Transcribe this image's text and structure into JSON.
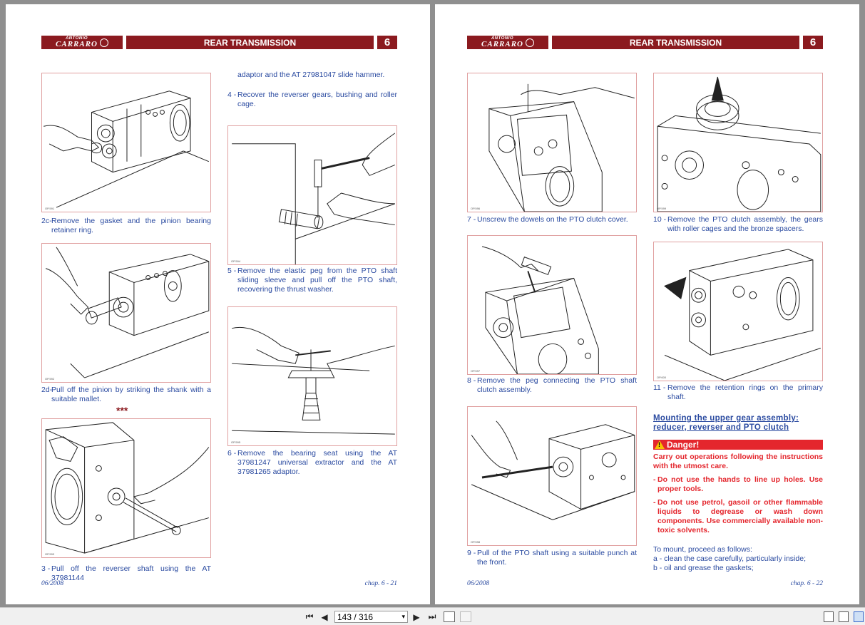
{
  "header": {
    "brand_top": "ANTONIO",
    "brand_bottom": "CARRARO",
    "section_title": "REAR TRANSMISSION",
    "chapter_number": "6"
  },
  "left_page": {
    "fig1_code": "OP.591",
    "fig2_code": "OP.592",
    "fig3_code": "OP.593",
    "fig4_code": "OP.594",
    "fig5_code": "OP.595",
    "step_2c": {
      "num": "2c-",
      "text": "Remove the gasket and the pinion bearing retainer ring."
    },
    "step_2d": {
      "num": "2d-",
      "text": "Pull off the pinion by striking the shank with a suitable mallet."
    },
    "separator": "***",
    "step_3": {
      "num": "3 -",
      "text": "Pull off the reverser shaft using the AT 37981144"
    },
    "cont_text": "adaptor and the AT 27981047 slide hammer.",
    "step_4": {
      "num": "4 -",
      "text": "Recover the reverser gears, bushing and roller cage."
    },
    "step_5": {
      "num": "5 -",
      "text": "Remove the elastic peg from the PTO shaft sliding sleeve and pull off the PTO shaft, recovering the thrust washer."
    },
    "step_6": {
      "num": "6 -",
      "text": "Remove the bearing seat using the AT 37981247 universal extractor and the AT 37981265 adaptor."
    },
    "footer_date": "06/2008",
    "footer_page": "chap. 6 - 21"
  },
  "right_page": {
    "fig1_code": "OP.596",
    "fig2_code": "OP.597",
    "fig3_code": "OP.598",
    "fig4_code": "OP.599",
    "fig5_code": "OP.600",
    "step_7": {
      "num": "7 -",
      "text": "Unscrew the dowels on the PTO clutch cover."
    },
    "step_8": {
      "num": "8 -",
      "text": "Remove the peg connecting the PTO shaft clutch assembly."
    },
    "step_9": {
      "num": "9 -",
      "text": "Pull of the PTO shaft using a suitable punch at the front."
    },
    "step_10": {
      "num": "10 -",
      "text": "Remove the PTO clutch assembly, the gears with roller cages and the bronze spacers."
    },
    "step_11": {
      "num": "11 -",
      "text": "Remove the retention rings on the primary shaft."
    },
    "section_title": "Mounting the upper gear assembly: reducer, reverser and PTO clutch",
    "danger_label": "Danger!",
    "danger_intro": "Carry out operations following the instructions with the utmost care.",
    "danger_item_1": "Do not use the hands to line up holes. Use proper tools.",
    "danger_item_2": "Do not use petrol, gasoil or other flammable liquids to degrease or wash down components. Use commercially available non-toxic solvents.",
    "mount_intro": "To mount, proceed as follows:",
    "mount_a": "a - clean the case carefully, particularly inside;",
    "mount_b": "b - oil and grease the gaskets;",
    "footer_date": "06/2008",
    "footer_page": "chap. 6 - 22"
  },
  "toolbar": {
    "page_indicator": "143 / 316",
    "first_icon": "first-page-icon",
    "prev_icon": "prev-page-icon",
    "next_icon": "next-page-icon",
    "last_icon": "last-page-icon"
  },
  "colors": {
    "header_red": "#8b1a1f",
    "text_blue": "#2a4aa0",
    "danger_red": "#e4262d"
  }
}
